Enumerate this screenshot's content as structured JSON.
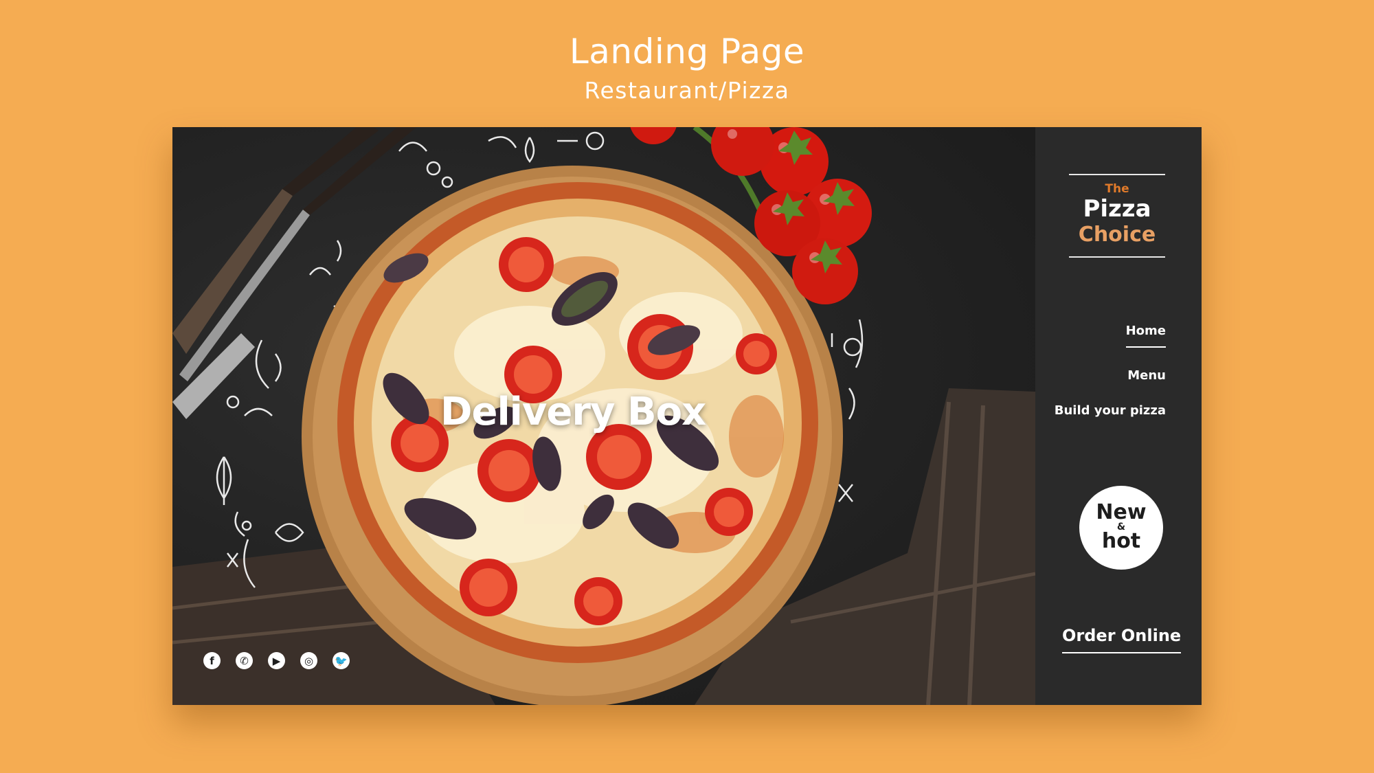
{
  "header": {
    "title": "Landing Page",
    "subtitle": "Restaurant/Pizza"
  },
  "hero": {
    "headline": "Delivery Box",
    "social": [
      {
        "icon": "facebook-icon",
        "glyph": "f"
      },
      {
        "icon": "whatsapp-icon",
        "glyph": "✆"
      },
      {
        "icon": "youtube-icon",
        "glyph": "▶"
      },
      {
        "icon": "instagram-icon",
        "glyph": "◎"
      },
      {
        "icon": "twitter-icon",
        "glyph": "🐦"
      }
    ]
  },
  "sidebar": {
    "logo": {
      "the": "The",
      "pizza": "Pizza",
      "choice": "Choice"
    },
    "nav": {
      "home": "Home",
      "menu": "Menu",
      "build": "Build your pizza"
    },
    "badge": {
      "line1": "New",
      "amp": "&",
      "line2": "hot"
    },
    "cta": "Order Online"
  },
  "colors": {
    "background": "#F5AC52",
    "sidebar": "#2A2A2A",
    "hero": "#242424",
    "accent_orange": "#E07A2A",
    "accent_tan": "#E8A064"
  }
}
